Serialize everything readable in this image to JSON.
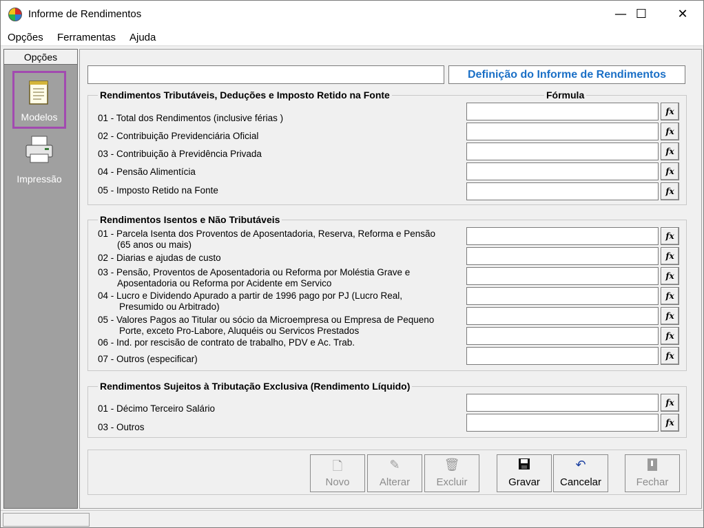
{
  "window": {
    "title": "Informe de Rendimentos",
    "minimize": "—",
    "maximize": "☐",
    "close": "✕"
  },
  "menu": [
    "Opções",
    "Ferramentas",
    "Ajuda"
  ],
  "sidebar": {
    "header": "Opções",
    "items": [
      {
        "label": "Modelos",
        "icon": "document-icon",
        "active": true
      },
      {
        "label": "Impressão",
        "icon": "printer-icon",
        "active": false
      }
    ]
  },
  "form": {
    "top_input_value": "",
    "title": "Definição do Informe de Rendimentos",
    "formula_header": "Fórmula",
    "fx_label": "fx",
    "groups": [
      {
        "title": "Rendimentos Tributáveis, Deduções e Imposto Retido na Fonte",
        "rows": [
          {
            "line1": "01 - Total dos Rendimentos (inclusive férias )",
            "line2": ""
          },
          {
            "line1": "02 - Contribuição Previdenciária Oficial",
            "line2": ""
          },
          {
            "line1": "03 - Contribuição à Previdência Privada",
            "line2": ""
          },
          {
            "line1": "04 - Pensão Alimentícia",
            "line2": ""
          },
          {
            "line1": "05 - Imposto Retido na Fonte",
            "line2": ""
          }
        ]
      },
      {
        "title": "Rendimentos Isentos e Não Tributáveis",
        "rows": [
          {
            "line1": "01 - Parcela Isenta dos Proventos de Aposentadoria, Reserva, Reforma e Pensão",
            "line2": "(65 anos ou mais)"
          },
          {
            "line1": "02 - Diarias e ajudas de custo",
            "line2": ""
          },
          {
            "line1": "03 - Pensão, Proventos de Aposentadoria ou Reforma por Moléstia Grave e",
            "line2": "Aposentadoria ou Reforma por Acidente em Servico"
          },
          {
            "line1": "04 - Lucro e Dividendo Apurado a partir de 1996 pago por PJ (Lucro Real,",
            "line2": "Presumido ou Arbitrado)"
          },
          {
            "line1": "05 - Valores Pagos ao Titular ou sócio da Microempresa ou Empresa de Pequeno",
            "line2": "Porte, exceto Pro-Labore, Aluquéis ou Servicos Prestados"
          },
          {
            "line1": "06 - Ind. por rescisão de contrato de trabalho, PDV e Ac. Trab.",
            "line2": ""
          },
          {
            "line1": "07 - Outros (especificar)",
            "line2": ""
          }
        ]
      },
      {
        "title": "Rendimentos Sujeitos à Tributação Exclusiva (Rendimento Líquido)",
        "rows": [
          {
            "line1": "01 - Décimo Terceiro Salário",
            "line2": ""
          },
          {
            "line1": "03 - Outros",
            "line2": ""
          }
        ]
      }
    ]
  },
  "buttons": [
    {
      "label": "Novo",
      "icon": "new-document-icon",
      "enabled": false
    },
    {
      "label": "Alterar",
      "icon": "edit-document-icon",
      "enabled": false
    },
    {
      "label": "Excluir",
      "icon": "delete-icon",
      "enabled": false
    },
    {
      "label": "Gravar",
      "icon": "save-icon",
      "enabled": true
    },
    {
      "label": "Cancelar",
      "icon": "undo-icon",
      "enabled": true
    },
    {
      "label": "Fechar",
      "icon": "exit-icon",
      "enabled": false
    }
  ],
  "status": {
    "text": ""
  }
}
